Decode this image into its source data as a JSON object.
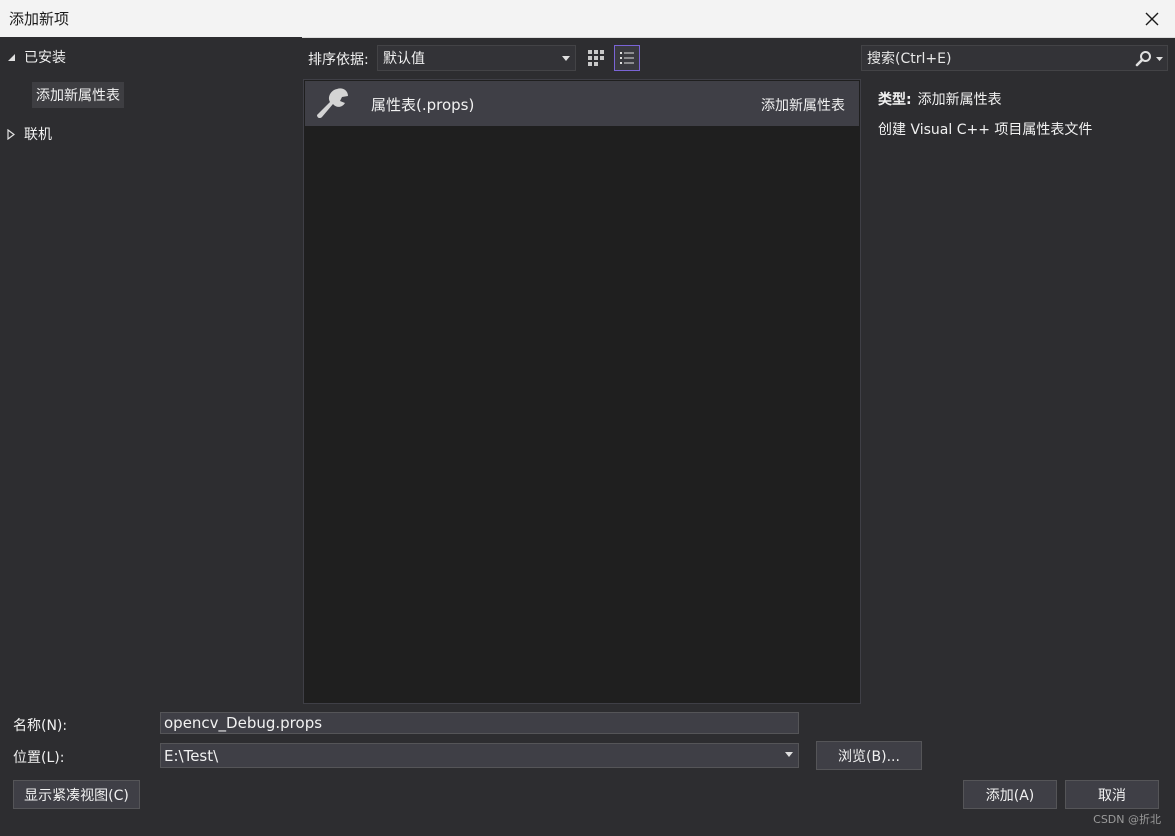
{
  "window": {
    "title": "添加新项"
  },
  "tree": {
    "installed": "已安装",
    "installed_child": "添加新属性表",
    "online": "联机"
  },
  "toolbar": {
    "sort_label": "排序依据:",
    "sort_value": "默认值",
    "search_placeholder": "搜索(Ctrl+E)"
  },
  "templates": [
    {
      "name": "属性表(.props)",
      "category": "添加新属性表",
      "icon": "wrench-icon"
    }
  ],
  "details": {
    "type_label": "类型:",
    "type_value": "添加新属性表",
    "description": "创建 Visual C++ 项目属性表文件"
  },
  "form": {
    "name_label": "名称(N):",
    "name_value": "opencv_Debug.props",
    "location_label": "位置(L):",
    "location_value": "E:\\Test\\",
    "browse_label": "浏览(B)...",
    "compact_view_label": "显示紧凑视图(C)",
    "add_label": "添加(A)",
    "cancel_label": "取消"
  },
  "watermark": "CSDN @折北"
}
